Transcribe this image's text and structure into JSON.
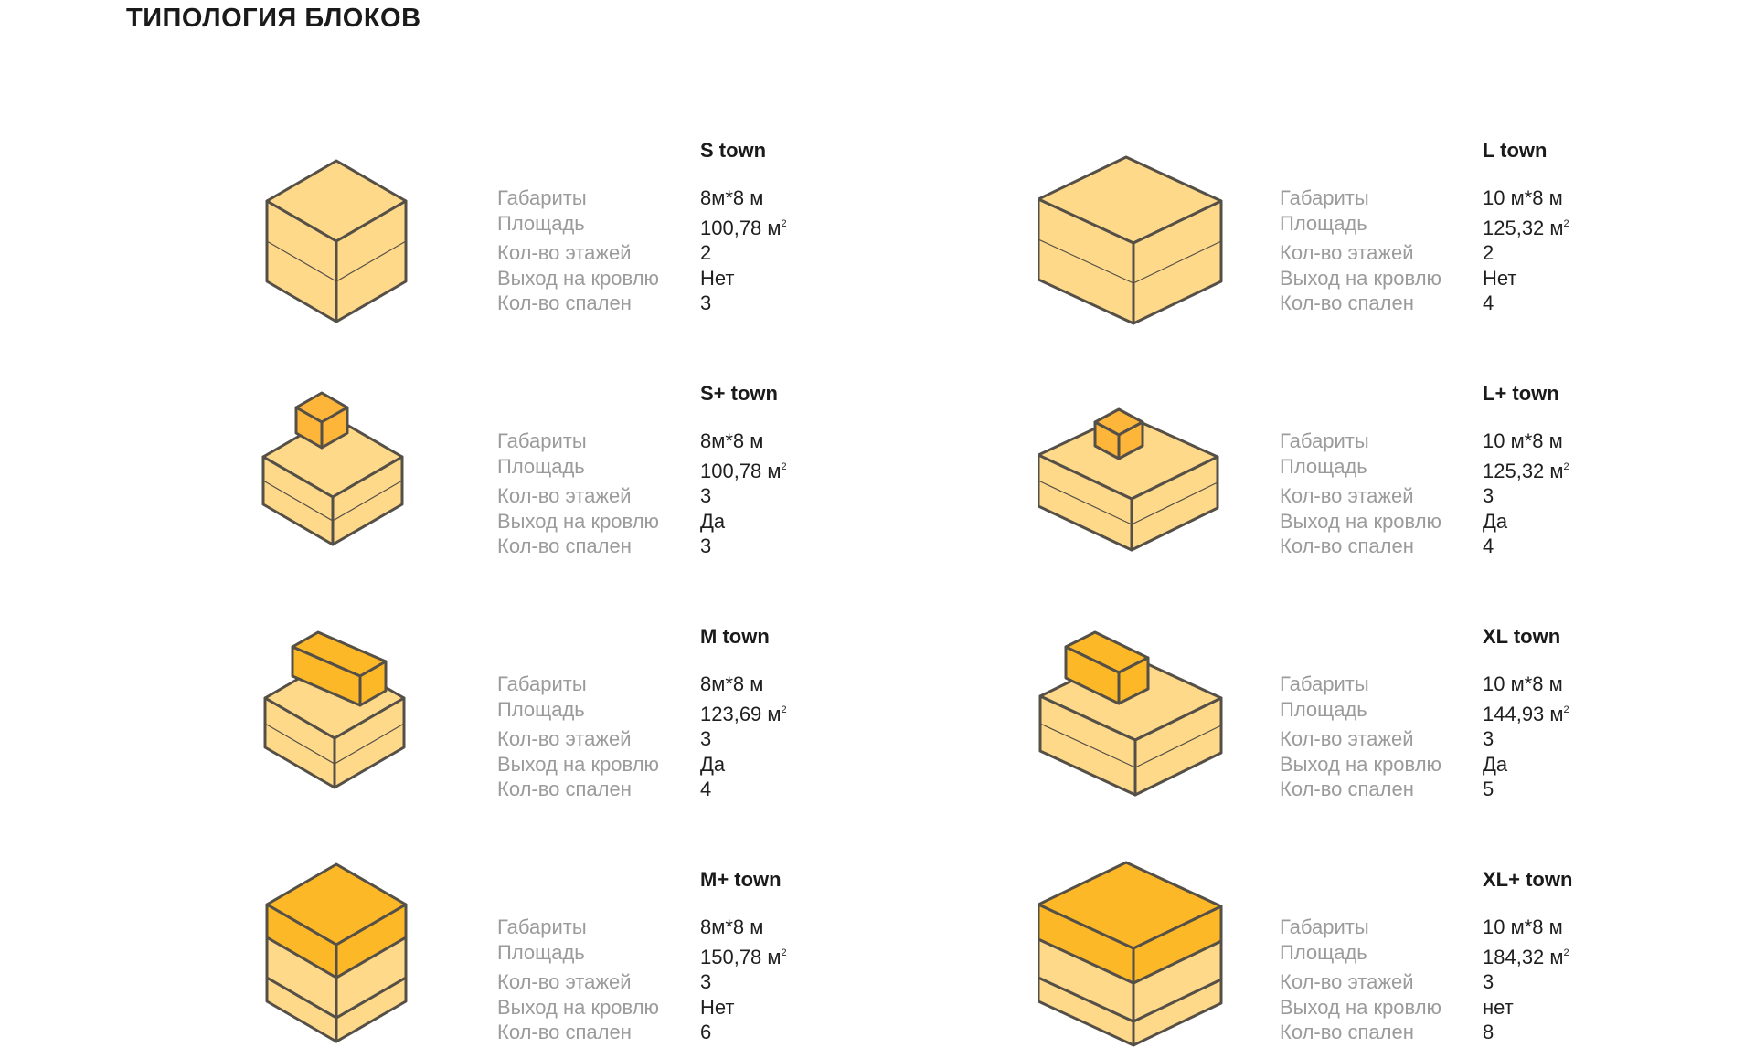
{
  "page": {
    "title": "ТИПОЛОГИЯ БЛОКОВ"
  },
  "labels": {
    "size": "Габариты",
    "area": "Площадь",
    "floors": "Кол-во этажей",
    "roof": "Выход на кровлю",
    "bedrooms": "Кол-во спален",
    "area_unit": "м",
    "area_unit_sup": "2"
  },
  "colors": {
    "base_light": "#FFD98A",
    "accent_dark": "#FDB827",
    "outline": "#555047",
    "text_muted": "#9b9b9b"
  },
  "blocks": [
    {
      "name": "S town",
      "size": "8м*8 м",
      "area": "100,78",
      "floors": "2",
      "roof": "Нет",
      "bedrooms": "3"
    },
    {
      "name": "L town",
      "size": "10 м*8 м",
      "area": "125,32",
      "floors": "2",
      "roof": "Нет",
      "bedrooms": "4"
    },
    {
      "name": "S+ town",
      "size": "8м*8 м",
      "area": "100,78",
      "floors": "3",
      "roof": "Да",
      "bedrooms": "3"
    },
    {
      "name": "L+ town",
      "size": "10 м*8 м",
      "area": "125,32",
      "floors": "3",
      "roof": "Да",
      "bedrooms": "4"
    },
    {
      "name": "M town",
      "size": "8м*8 м",
      "area": "123,69",
      "floors": "3",
      "roof": "Да",
      "bedrooms": "4"
    },
    {
      "name": "XL town",
      "size": "10 м*8 м",
      "area": "144,93",
      "floors": "3",
      "roof": "Да",
      "bedrooms": "5"
    },
    {
      "name": "M+ town",
      "size": "8м*8 м",
      "area": "150,78",
      "floors": "3",
      "roof": "Нет",
      "bedrooms": "6"
    },
    {
      "name": "XL+ town",
      "size": "10 м*8 м",
      "area": "184,32",
      "floors": "3",
      "roof": "нет",
      "bedrooms": "8"
    }
  ]
}
